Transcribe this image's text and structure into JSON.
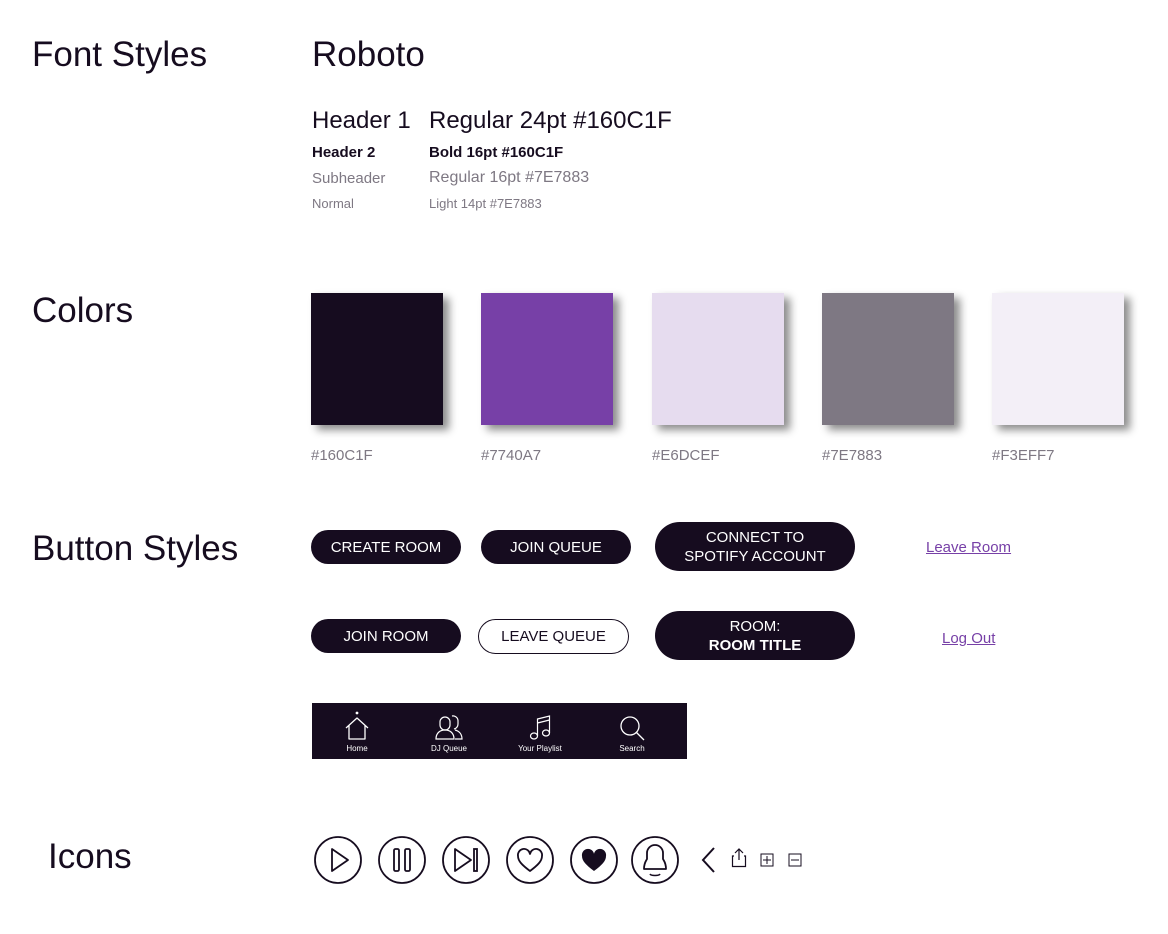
{
  "sections": {
    "font_styles": "Font Styles",
    "colors": "Colors",
    "button_styles": "Button Styles",
    "icons": "Icons"
  },
  "font_family": "Roboto",
  "typography": [
    {
      "label": "Header 1",
      "spec": "Regular 24pt #160C1F"
    },
    {
      "label": "Header 2",
      "spec": "Bold 16pt #160C1F"
    },
    {
      "label": "Subheader",
      "spec": "Regular 16pt #7E7883"
    },
    {
      "label": "Normal",
      "spec": "Light 14pt #7E7883"
    }
  ],
  "colors": [
    {
      "hex": "#160C1F",
      "label": "#160C1F"
    },
    {
      "hex": "#7740A7",
      "label": "#7740A7"
    },
    {
      "hex": "#E6DCEF",
      "label": "#E6DCEF"
    },
    {
      "hex": "#7E7883",
      "label": "#7E7883"
    },
    {
      "hex": "#F3EFF7",
      "label": "#F3EFF7"
    }
  ],
  "buttons": {
    "create_room": "CREATE ROOM",
    "join_queue": "JOIN QUEUE",
    "connect_line1": "CONNECT TO",
    "connect_line2": "SPOTIFY ACCOUNT",
    "leave_room": "Leave Room",
    "join_room": "JOIN ROOM",
    "leave_queue": "LEAVE QUEUE",
    "room_line1": "ROOM:",
    "room_line2": "ROOM TITLE",
    "log_out": "Log Out"
  },
  "navbar": {
    "items": [
      {
        "label": "Home",
        "icon": "home-icon",
        "active": true
      },
      {
        "label": "DJ Queue",
        "icon": "users-icon"
      },
      {
        "label": "Your Playlist",
        "icon": "music-note-icon"
      },
      {
        "label": "Search",
        "icon": "search-icon"
      }
    ]
  },
  "icons": [
    "play-icon",
    "pause-icon",
    "skip-next-icon",
    "heart-outline-icon",
    "heart-filled-icon",
    "profile-icon",
    "chevron-left-icon",
    "share-icon",
    "expand-icon",
    "collapse-icon"
  ]
}
